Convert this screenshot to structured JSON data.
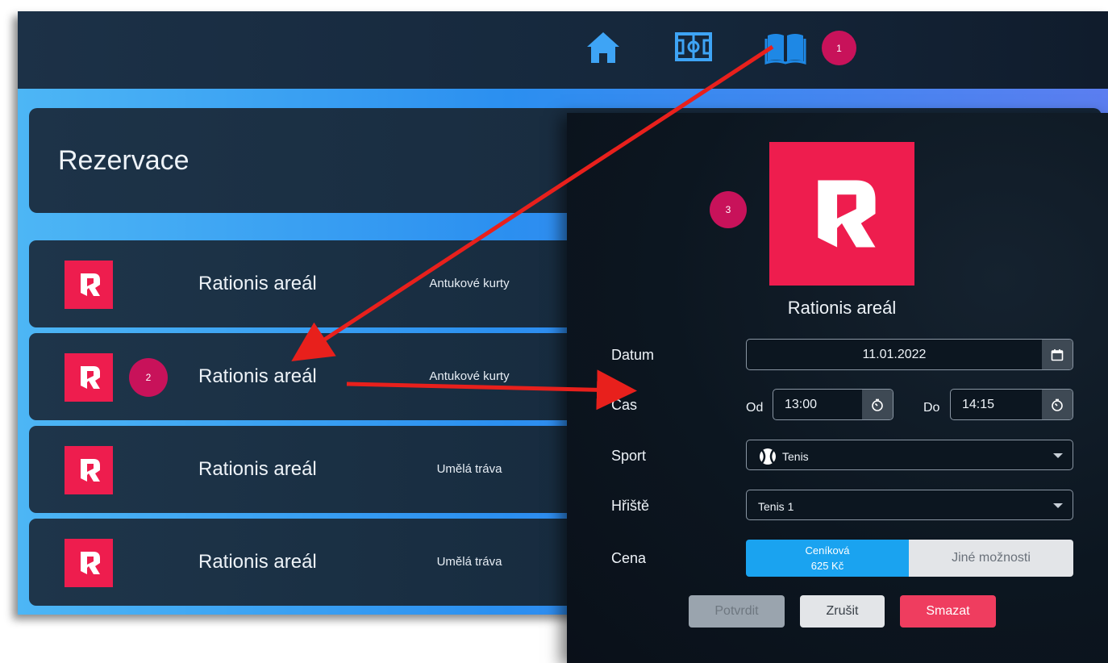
{
  "nav": {
    "items": [
      {
        "name": "home",
        "icon": "home-icon"
      },
      {
        "name": "field",
        "icon": "football-field-icon"
      },
      {
        "name": "book",
        "icon": "book-icon"
      }
    ]
  },
  "badges": {
    "one": "1",
    "two": "2",
    "three": "3"
  },
  "header": {
    "title": "Rezervace"
  },
  "reservations": [
    {
      "name": "Rationis areál",
      "type": "Antukové kurty"
    },
    {
      "name": "Rationis areál",
      "type": "Antukové kurty"
    },
    {
      "name": "Rationis areál",
      "type": "Umělá tráva"
    },
    {
      "name": "Rationis areál",
      "type": "Umělá tráva"
    }
  ],
  "dialog": {
    "place": "Rationis areál",
    "date_label": "Datum",
    "date_value": "11.01.2022",
    "time_label": "Čas",
    "from_label": "Od",
    "from_value": "13:00",
    "to_label": "Do",
    "to_value": "14:15",
    "sport_label": "Sport",
    "sport_value": "Tenis",
    "court_label": "Hřiště",
    "court_value": "Tenis 1",
    "price_label": "Cena",
    "price_active_title": "Ceníková",
    "price_active_amount": "625 Kč",
    "price_other": "Jiné možnosti",
    "confirm": "Potvrdit",
    "cancel": "Zrušit",
    "delete": "Smazat"
  },
  "colors": {
    "brand": "#ee1d4e",
    "badge": "#c8125a",
    "accent": "#1aa3f0",
    "delete": "#ef3d5f",
    "arrow": "#e8201c"
  }
}
